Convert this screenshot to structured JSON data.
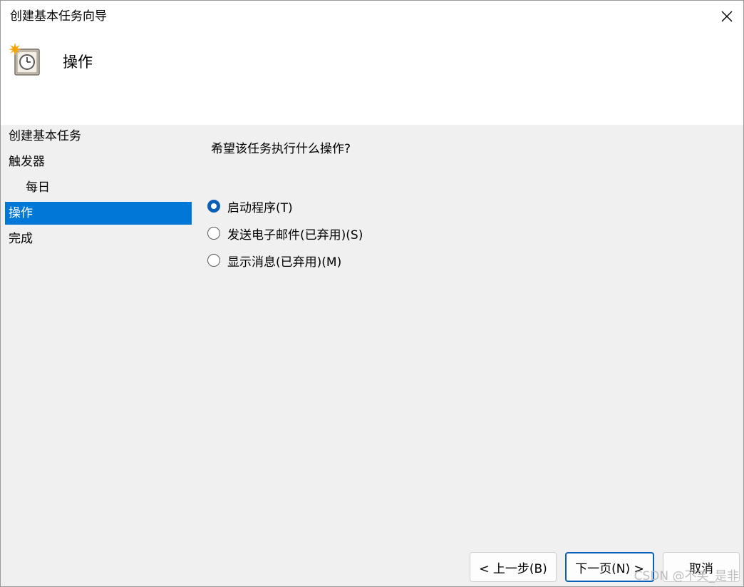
{
  "window": {
    "title": "创建基本任务向导",
    "close_icon": "close-icon"
  },
  "header": {
    "icon": "task-scheduler-clock-icon",
    "title": "操作"
  },
  "steps": [
    {
      "label": "创建基本任务",
      "level": 0,
      "active": false
    },
    {
      "label": "触发器",
      "level": 0,
      "active": false
    },
    {
      "label": "每日",
      "level": 1,
      "active": false
    },
    {
      "label": "操作",
      "level": 0,
      "active": true
    },
    {
      "label": "完成",
      "level": 0,
      "active": false
    }
  ],
  "main": {
    "question": "希望该任务执行什么操作?",
    "options": [
      {
        "label": "启动程序(T)",
        "checked": true
      },
      {
        "label": "发送电子邮件(已弃用)(S)",
        "checked": false
      },
      {
        "label": "显示消息(已弃用)(M)",
        "checked": false
      }
    ]
  },
  "buttons": {
    "back": "< 上一步(B)",
    "next": "下一页(N) >",
    "cancel": "取消"
  },
  "watermark": "CSDN @不笑_是非",
  "colors": {
    "accent": "#0078d7",
    "radio_checked": "#0a5fb7",
    "panel_bg": "#f0f0f0"
  }
}
